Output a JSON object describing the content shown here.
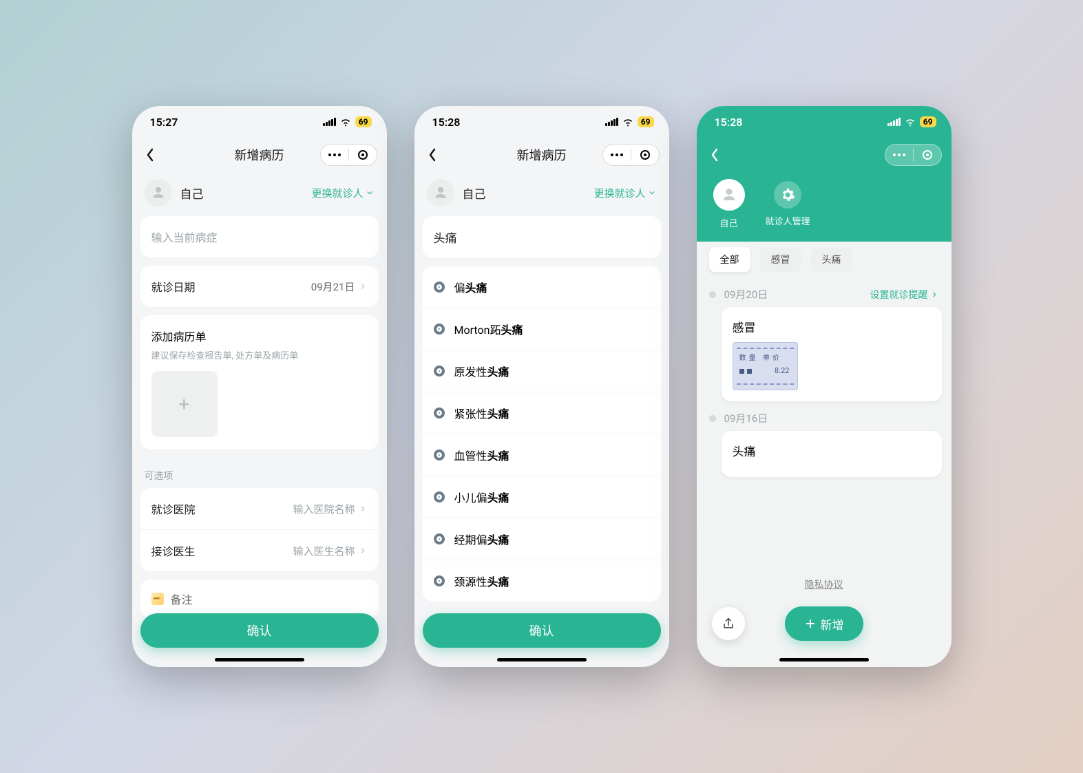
{
  "battery": "69",
  "s1": {
    "time": "15:27",
    "title": "新增病历",
    "person": "自己",
    "switch": "更换就诊人",
    "symptom_ph": "输入当前病症",
    "date_lbl": "就诊日期",
    "date_val": "09月21日",
    "attach_lbl": "添加病历单",
    "attach_sub": "建议保存检查报告单, 处方单及病历单",
    "optional": "可选项",
    "hospital_lbl": "就诊医院",
    "hospital_ph": "输入医院名称",
    "doctor_lbl": "接诊医生",
    "doctor_ph": "输入医生名称",
    "note": "备注",
    "confirm": "确认"
  },
  "s2": {
    "time": "15:28",
    "title": "新增病历",
    "person": "自己",
    "switch": "更换就诊人",
    "query": "头痛",
    "kw": "头痛",
    "sugg": [
      "偏头痛",
      "Morton跖头痛",
      "原发性头痛",
      "紧张性头痛",
      "血管性头痛",
      "小儿偏头痛",
      "经期偏头痛",
      "颈源性头痛"
    ],
    "confirm": "确认"
  },
  "s3": {
    "time": "15:28",
    "person": "自己",
    "manage": "就诊人管理",
    "tabs": [
      "全部",
      "感冒",
      "头痛"
    ],
    "remind": "设置就诊提醒",
    "tl": [
      {
        "date": "09月20日",
        "title": "感冒",
        "receipt": {
          "cols": "数量  单价",
          "amt": "8.22"
        }
      },
      {
        "date": "09月16日",
        "title": "头痛"
      }
    ],
    "privacy": "隐私协议",
    "new": "新增"
  }
}
